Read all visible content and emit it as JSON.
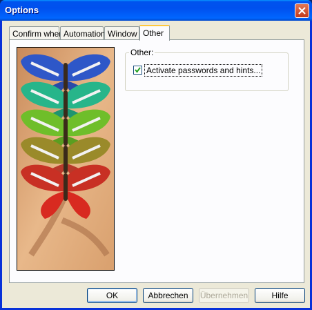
{
  "window": {
    "title": "Options"
  },
  "tabs": [
    {
      "label": "Confirm when"
    },
    {
      "label": "Automation"
    },
    {
      "label": "Window"
    },
    {
      "label": "Other"
    }
  ],
  "other": {
    "group_label": "Other:",
    "checkbox_label": "Activate passwords and hints...",
    "checkbox_checked": true
  },
  "buttons": {
    "ok": "OK",
    "cancel": "Abbrechen",
    "apply": "Übernehmen",
    "help": "Hilfe"
  },
  "picture": {
    "description_icon": "butterfly-image",
    "colors": [
      "#2E57C8",
      "#27B58A",
      "#6FBE2A",
      "#9A8A2A",
      "#C83024"
    ]
  }
}
